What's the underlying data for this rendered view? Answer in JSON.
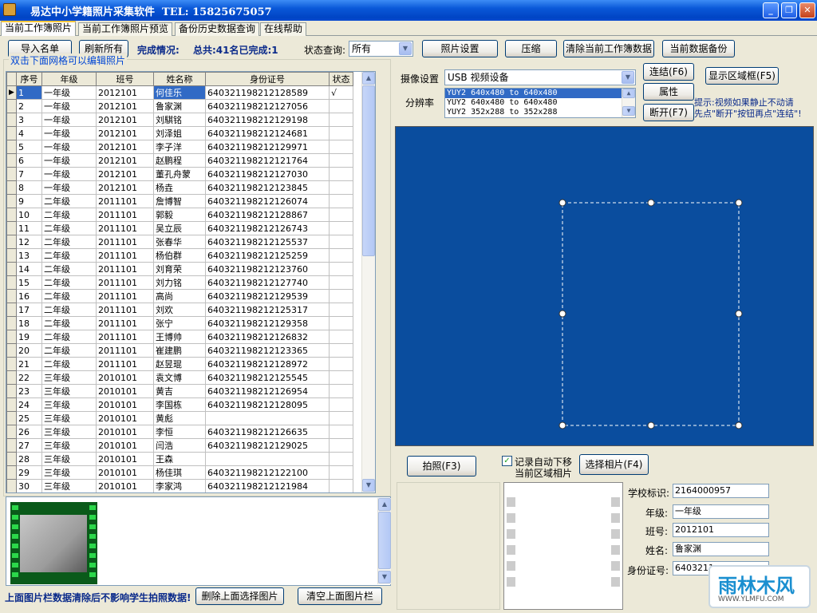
{
  "window": {
    "title": "易达中小学籍照片采集软件  TEL: 15825675057"
  },
  "tabs": [
    {
      "label": "当前工作簿照片"
    },
    {
      "label": "当前工作簿照片预览"
    },
    {
      "label": "备份历史数据查询"
    },
    {
      "label": "在线帮助"
    }
  ],
  "toolbar": {
    "import_label": "导入名单",
    "refresh_label": "刷新所有",
    "completion_label": "完成情况:",
    "completion_value": "总共:41名已完成:1",
    "status_query_label": "状态查询:",
    "status_query_value": "所有",
    "photo_settings_label": "照片设置",
    "compress_label": "压缩",
    "clear_workbook_label": "清除当前工作簿数据",
    "backup_label": "当前数据备份"
  },
  "grid": {
    "caption": "双击下面网格可以编辑照片",
    "columns": [
      "序号",
      "年级",
      "班号",
      "姓名称",
      "身份证号",
      "状态"
    ],
    "rows": [
      [
        "1",
        "一年级",
        "2012101",
        "何佳乐",
        "640321198212128589",
        "√"
      ],
      [
        "2",
        "一年级",
        "2012101",
        "鲁家渊",
        "640321198212127056",
        ""
      ],
      [
        "3",
        "一年级",
        "2012101",
        "刘騏铭",
        "640321198212129198",
        ""
      ],
      [
        "4",
        "一年级",
        "2012101",
        "刘泽姐",
        "640321198212124681",
        ""
      ],
      [
        "5",
        "一年级",
        "2012101",
        "李子洋",
        "640321198212129971",
        ""
      ],
      [
        "6",
        "一年级",
        "2012101",
        "赵鹏程",
        "640321198212121764",
        ""
      ],
      [
        "7",
        "一年级",
        "2012101",
        "董孔舟蒙",
        "640321198212127030",
        ""
      ],
      [
        "8",
        "一年级",
        "2012101",
        "杨垚",
        "640321198212123845",
        ""
      ],
      [
        "9",
        "二年级",
        "2011101",
        "詹博智",
        "640321198212126074",
        ""
      ],
      [
        "10",
        "二年级",
        "2011101",
        "郭毅",
        "640321198212128867",
        ""
      ],
      [
        "11",
        "二年级",
        "2011101",
        "吴立辰",
        "640321198212126743",
        ""
      ],
      [
        "12",
        "二年级",
        "2011101",
        "张春华",
        "640321198212125537",
        ""
      ],
      [
        "13",
        "二年级",
        "2011101",
        "杨伯群",
        "640321198212125259",
        ""
      ],
      [
        "14",
        "二年级",
        "2011101",
        "刘育荣",
        "640321198212123760",
        ""
      ],
      [
        "15",
        "二年级",
        "2011101",
        "刘力铭",
        "640321198212127740",
        ""
      ],
      [
        "16",
        "二年级",
        "2011101",
        "高尚",
        "640321198212129539",
        ""
      ],
      [
        "17",
        "二年级",
        "2011101",
        "刘欢",
        "640321198212125317",
        ""
      ],
      [
        "18",
        "二年级",
        "2011101",
        "张宁",
        "640321198212129358",
        ""
      ],
      [
        "19",
        "二年级",
        "2011101",
        "王博帅",
        "640321198212126832",
        ""
      ],
      [
        "20",
        "二年级",
        "2011101",
        "崔建鹏",
        "640321198212123365",
        ""
      ],
      [
        "21",
        "二年级",
        "2011101",
        "赵昱琨",
        "640321198212128972",
        ""
      ],
      [
        "22",
        "三年级",
        "2010101",
        "袁文博",
        "640321198212125545",
        ""
      ],
      [
        "23",
        "三年级",
        "2010101",
        "黄吉",
        "640321198212126954",
        ""
      ],
      [
        "24",
        "三年级",
        "2010101",
        "李国栋",
        "640321198212128095",
        ""
      ],
      [
        "25",
        "三年级",
        "2010101",
        "黄彪",
        "",
        ""
      ],
      [
        "26",
        "三年级",
        "2010101",
        "李恒",
        "640321198212126635",
        ""
      ],
      [
        "27",
        "三年级",
        "2010101",
        "闫浩",
        "640321198212129025",
        ""
      ],
      [
        "28",
        "三年级",
        "2010101",
        "王森",
        "",
        ""
      ],
      [
        "29",
        "三年级",
        "2010101",
        "杨佳琪",
        "640321198212122100",
        ""
      ],
      [
        "30",
        "三年级",
        "2010101",
        "李家鸿",
        "640321198212121984",
        ""
      ]
    ]
  },
  "camera": {
    "device_label": "摄像设置",
    "device_value": "USB 视频设备",
    "resolution_label": "分辨率",
    "resolutions": [
      "YUY2 640x480 to 640x480",
      "YUY2 640x480 to 640x480",
      "YUY2 352x288 to 352x288"
    ],
    "connect_label": "连结(F6)",
    "properties_label": "属性",
    "disconnect_label": "断开(F7)",
    "show_frame_label": "显示区域框(F5)",
    "hint_line1": "提示:视频如果静止不动请",
    "hint_line2": "先点\"断开\"按钮再点\"连结\"!"
  },
  "capture": {
    "shoot_label": "拍照(F3)",
    "auto_move_label_line1": "记录自动下移",
    "auto_move_label_line2": "当前区域相片",
    "auto_move_checked": "✓",
    "select_photo_label": "选择相片(F4)"
  },
  "student": {
    "school_id_label": "学校标识:",
    "school_id_value": "2164000957",
    "grade_label": "年级:",
    "grade_value": "一年级",
    "class_label": "班号:",
    "class_value": "2012101",
    "name_label": "姓名:",
    "name_value": "鲁家渊",
    "id_label": "身份证号:",
    "id_value": "6403211"
  },
  "footer": {
    "note": "上面图片栏数据清除后不影响学生拍照数据!",
    "delete_selected_label": "删除上面选择图片",
    "clear_strip_label": "清空上面图片栏"
  },
  "watermark": {
    "name": "雨林木风",
    "url": "WWW.YLMFU.COM"
  }
}
